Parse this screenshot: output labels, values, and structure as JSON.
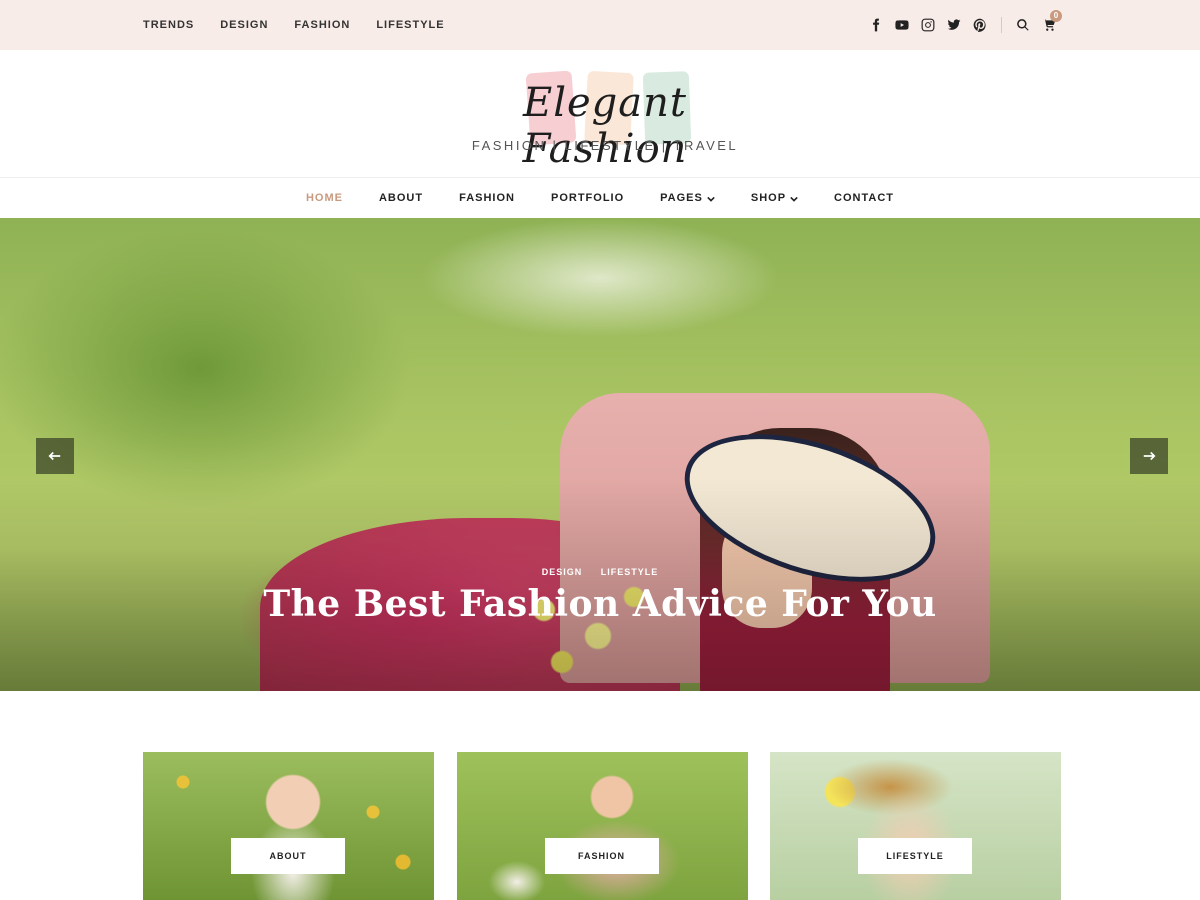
{
  "topbar": {
    "links": [
      "TRENDS",
      "DESIGN",
      "FASHION",
      "LIFESTYLE"
    ],
    "social_icons": [
      "facebook-icon",
      "youtube-icon",
      "instagram-icon",
      "twitter-icon",
      "pinterest-icon"
    ],
    "cart_count": "0"
  },
  "logo": {
    "title": "Elegant Fashion",
    "tagline": "FASHION | LIFESTYLE | TRAVEL"
  },
  "nav": {
    "items": [
      "HOME",
      "ABOUT",
      "FASHION",
      "PORTFOLIO",
      "PAGES",
      "SHOP",
      "CONTACT"
    ],
    "active": "HOME"
  },
  "hero": {
    "categories": [
      "DESIGN",
      "LIFESTYLE"
    ],
    "title": "The Best Fashion Advice For You"
  },
  "cards": [
    {
      "label": "ABOUT"
    },
    {
      "label": "FASHION"
    },
    {
      "label": "LIFESTYLE"
    }
  ],
  "colors": {
    "topbar_bg": "#f8ece8",
    "accent": "#c99a7f"
  }
}
